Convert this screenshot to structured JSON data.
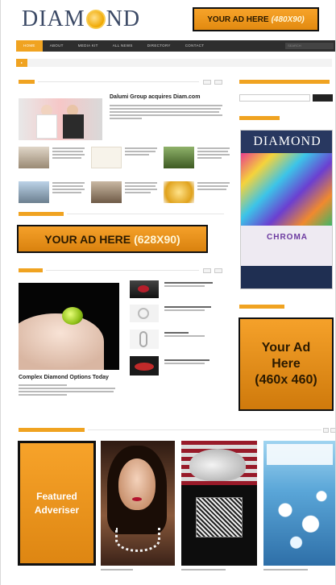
{
  "site": {
    "logo_text": "DIAM",
    "logo_text2": "ND",
    "logo_tag": ""
  },
  "ads": {
    "top": "YOUR AD HERE",
    "top_size": "(480X90)",
    "mid": "YOUR AD HERE",
    "mid_size": "(628X90)",
    "side_line1": "Your Ad",
    "side_line2": "Here",
    "side_line3": "(460x 460)",
    "featured_line1": "Featured",
    "featured_line2": "Adveriser"
  },
  "nav": {
    "items": [
      "HOME",
      "ABOUT",
      "MEDIA KIT",
      "ALL NEWS",
      "DIRECTORY",
      "CONTACT"
    ],
    "search_placeholder": "SEARCH"
  },
  "news": {
    "headline": "Dalumi Group acquires Diam.com",
    "more_headline": "Complex Diamond Options Today"
  },
  "magazine": {
    "brand": "DIAMOND",
    "cover_word": "CHROMA"
  }
}
